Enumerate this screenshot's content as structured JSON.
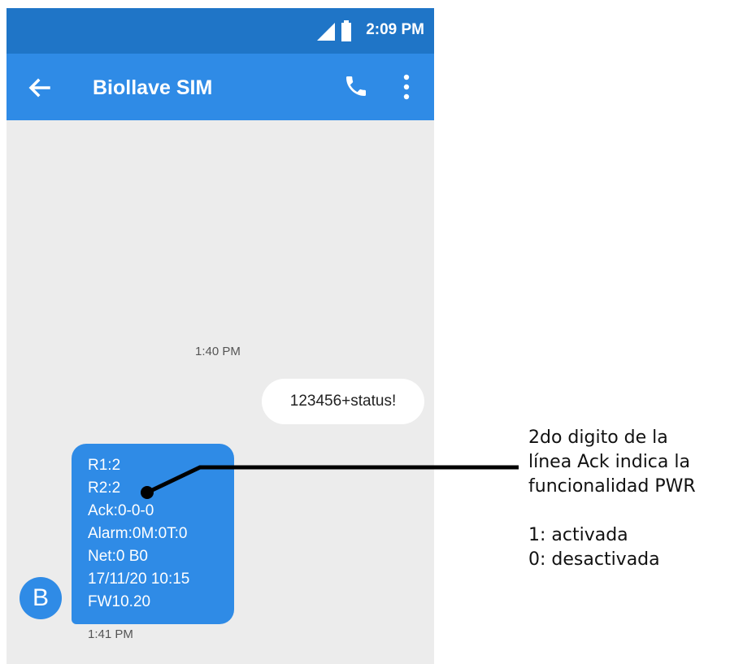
{
  "status_bar": {
    "time": "2:09 PM",
    "icons": [
      "signal-icon",
      "battery-icon"
    ]
  },
  "app_bar": {
    "title": "Biollave SIM",
    "icons": [
      "back-arrow-icon",
      "phone-icon",
      "more-vert-icon"
    ]
  },
  "conversation": {
    "sent_timestamp": "1:40 PM",
    "sent_message": "123456+status!",
    "received_lines": [
      "R1:2",
      "R2:2",
      "Ack:0-0-0",
      "Alarm:0M:0T:0",
      "Net:0 B0",
      "17/11/20 10:15",
      "FW10.20"
    ],
    "received_timestamp": "1:41 PM",
    "avatar_letter": "B"
  },
  "annotation": {
    "lines": [
      "2do digito de la",
      "línea Ack indica la",
      "funcionalidad PWR",
      "",
      "1: activada",
      "0: desactivada"
    ]
  },
  "colors": {
    "status_bar": "#1f75c7",
    "app_bar": "#2f8be6",
    "background": "#ececec",
    "received_bubble": "#2f8be6"
  }
}
